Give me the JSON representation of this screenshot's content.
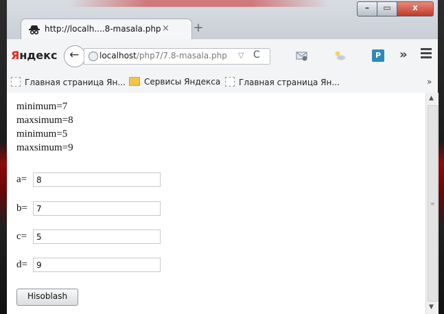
{
  "browser": {
    "tab_title": "http://localh....8-masala.php",
    "tab_close": "×",
    "new_tab": "+",
    "window_buttons": {
      "minimize": "–",
      "maximize": "▭",
      "close": "x"
    },
    "logo": {
      "first": "Я",
      "rest": "ндекс"
    },
    "back": "←",
    "url": {
      "host": "localhost",
      "path": "/php7/7.8-masala.php"
    },
    "url_dropdown": "▽",
    "reload": "C",
    "overflow": "»",
    "bookmarks": [
      "Главная страница Ян...",
      "Сервисы Яндекса",
      "Главная страница Ян..."
    ],
    "bookmarks_more": "»",
    "icons": {
      "tab": "spy-icon",
      "site": "globe-icon",
      "mail": "mail-icon",
      "weather": "weather-icon",
      "ext": "parking-icon",
      "menu": "menu-icon"
    }
  },
  "page": {
    "output_lines": [
      "minimum=7",
      "maxsimum=8",
      "minimum=5",
      "maxsimum=9"
    ],
    "fields": [
      {
        "label": "a=",
        "value": "8"
      },
      {
        "label": "b=",
        "value": "7"
      },
      {
        "label": "c=",
        "value": "5"
      },
      {
        "label": "d=",
        "value": "9"
      }
    ],
    "submit_label": "Hisoblash"
  },
  "scrollbar": {
    "up": "▲",
    "grip": "≡",
    "down": "▼"
  }
}
